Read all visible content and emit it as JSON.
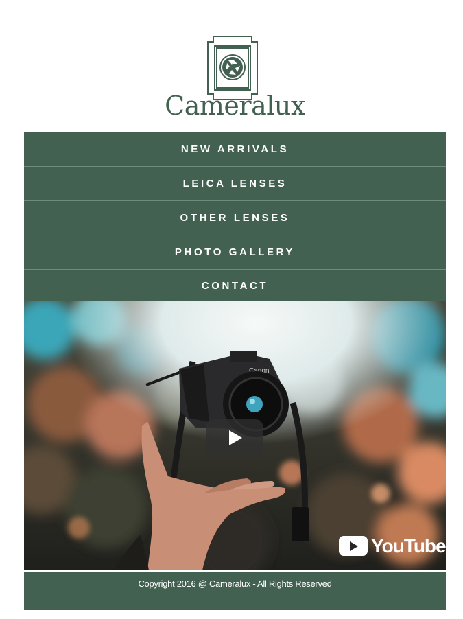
{
  "brand": {
    "name": "Cameralux",
    "color": "#436150"
  },
  "nav": {
    "items": [
      {
        "label": "NEW ARRIVALS"
      },
      {
        "label": "LEICA LENSES"
      },
      {
        "label": "OTHER LENSES"
      },
      {
        "label": "PHOTO GALLERY"
      },
      {
        "label": "CONTACT"
      }
    ]
  },
  "video": {
    "provider": "YouTube",
    "play_icon": "play-icon"
  },
  "footer": {
    "copyright": "Copyright 2016 @ Cameralux - All Rights Reserved"
  }
}
